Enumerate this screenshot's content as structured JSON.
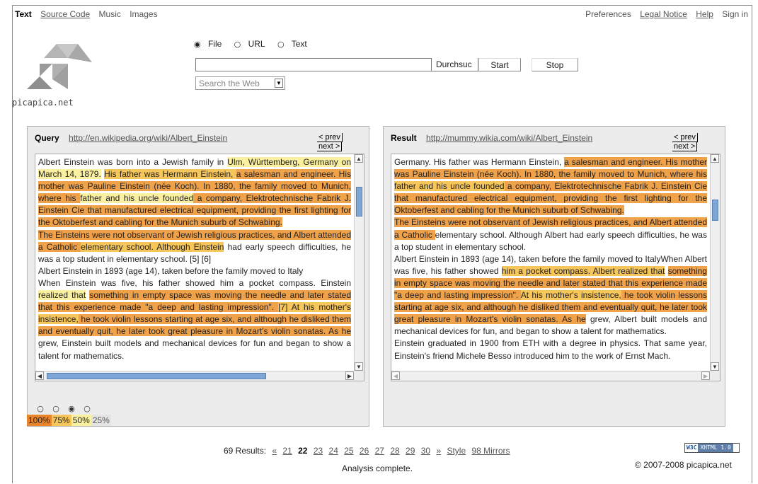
{
  "nav": {
    "left": [
      "Text",
      "Source Code",
      "Music",
      "Images"
    ],
    "right": [
      "Preferences",
      "Legal Notice",
      "Help",
      "Sign in"
    ]
  },
  "logo": {
    "text": "picapica.net"
  },
  "search": {
    "radio_options": [
      "File",
      "URL",
      "Text"
    ],
    "selected_radio": "File",
    "file_value": "",
    "browse_label": "Durchsuc",
    "start_label": "Start",
    "stop_label": "Stop",
    "engine_select": "Search the Web"
  },
  "query_panel": {
    "label": "Query",
    "url": "http://en.wikipedia.org/wiki/Albert_Einstein",
    "prev_label": "< prev",
    "next_label": "next >"
  },
  "result_panel": {
    "label": "Result",
    "url": "http://mummy.wikia.com/wiki/Albert_Einstein",
    "prev_label": "< prev",
    "next_label": "next >"
  },
  "query_text": [
    [
      [
        "n",
        "Albert Einstein was born into a Jewish family in "
      ],
      [
        "h50",
        "Ulm, Württemberg, Germany on March 14, 1879."
      ],
      [
        "n",
        " "
      ],
      [
        "h75",
        "His father was Hermann Einstein, "
      ],
      [
        "h100",
        "a salesman and engineer. His mother was Pauline Einstein (née Koch). In 1880, the family moved to Munich, where his "
      ],
      [
        "h50",
        "father and his uncle founded"
      ],
      [
        "h100",
        " a company, Elektrotechnische Fabrik J. Einstein Cie that manufactured electrical equipment, providing the first lighting for the Oktoberfest and cabling for the Munich suburb of Schwabing."
      ]
    ],
    [
      [
        "h100",
        "The Einsteins were not observant of Jewish religious practices, and Albert attended a Catholic "
      ],
      [
        "h75",
        "elementary school. Although Einstein"
      ],
      [
        "n",
        " had early speech difficulties, he was a top student in elementary school. [5] [6]"
      ]
    ],
    [
      [
        "n",
        " "
      ]
    ],
    [
      [
        "n",
        "Albert Einstein in 1893 (age 14), taken before the family moved to Italy"
      ]
    ],
    [
      [
        "n",
        "When Einstein was five, his father showed him a pocket compass. Einstein "
      ],
      [
        "h50",
        "realized that"
      ],
      [
        "n",
        " "
      ],
      [
        "h100",
        "something in empty space was moving the needle and later stated that this experience made \"a deep and lasting impression\". "
      ],
      [
        "h75",
        "[7] At his mother's insistence,"
      ],
      [
        "h100",
        " he took violin lessons starting at age six, and although he disliked them and eventually quit, he later took great pleasure in Mozart's violin sonatas. As he"
      ],
      [
        "n",
        " grew, Einstein built models and mechanical devices for fun and began to show a talent for mathematics."
      ]
    ]
  ],
  "result_text": [
    [
      [
        "n",
        "Germany. His father was Hermann Einstein, "
      ],
      [
        "h100",
        "a salesman and engineer. His mother was Pauline Einstein (née Koch). In 1880, the family moved to Munich, where his "
      ],
      [
        "h75",
        "father and his uncle founded"
      ],
      [
        "h100",
        " a company, Elektrotechnische Fabrik J. Einstein Cie that manufactured electrical equipment, providing the first lighting for the Oktoberfest and cabling for the Munich suburb of Schwabing."
      ]
    ],
    [
      [
        "h100",
        "The Einsteins were not observant of Jewish religious practices, and Albert attended a Catholic "
      ],
      [
        "n",
        "elementary school. Although Albert had early speech difficulties, he was a top student in elementary school."
      ]
    ],
    [
      [
        "n",
        "Albert Einstein in 1893 (age 14), taken before the family moved to ItalyWhen Albert was five, his father showed "
      ],
      [
        "h75",
        "him a pocket compass. Albert realized that"
      ],
      [
        "n",
        " "
      ],
      [
        "h100",
        "something in empty space was moving the needle and later stated that this experience made \"a deep and lasting impression\". "
      ],
      [
        "h75",
        "At his mother's insistence,"
      ],
      [
        "h100",
        " he took violin lessons starting at age six, and although he disliked them and eventually quit, he later took great pleasure in Mozart's violin sonatas. As he"
      ],
      [
        "n",
        " grew, Albert built models and mechanical devices for fun, and began to show a talent for mathematics."
      ]
    ],
    [
      [
        "n",
        "Einstein graduated in 1900 from ETH with a degree in physics. That same year, Einstein's friend Michele Besso introduced him to the work of Ernst Mach."
      ]
    ]
  ],
  "legend": {
    "levels": [
      "100%",
      "75%",
      "50%",
      "25%"
    ],
    "selected": "50%",
    "colors": {
      "100%": "#e8852a",
      "75%": "#f6c65a",
      "50%": "#faf0a0",
      "25%": "#e4e4e4"
    }
  },
  "footer": {
    "results_label": "69 Results:",
    "first": "«",
    "pages": [
      "21",
      "22",
      "23",
      "24",
      "25",
      "26",
      "27",
      "28",
      "29",
      "30"
    ],
    "current_page": "22",
    "last": "»",
    "style_label": "Style",
    "mirrors_label": "98 Mirrors",
    "status": "Analysis complete.",
    "copyright": "© 2007-2008 picapica.net",
    "badge_w3c": "W3C",
    "badge_text": "XHTML 1.0"
  }
}
